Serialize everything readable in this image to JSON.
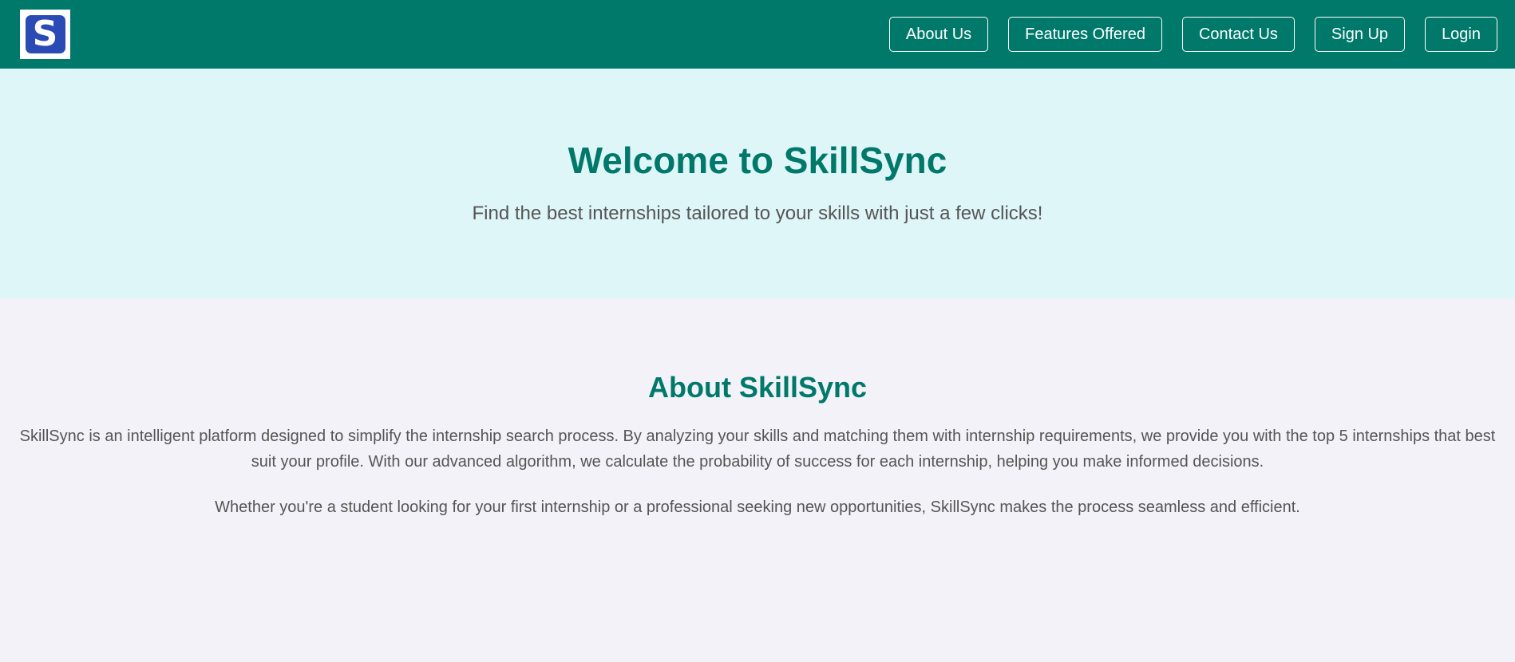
{
  "logo": {
    "letter": "S"
  },
  "nav": {
    "items": [
      {
        "label": "About Us"
      },
      {
        "label": "Features Offered"
      },
      {
        "label": "Contact Us"
      },
      {
        "label": "Sign Up"
      },
      {
        "label": "Login"
      }
    ]
  },
  "hero": {
    "title": "Welcome to SkillSync",
    "subtitle": "Find the best internships tailored to your skills with just a few clicks!"
  },
  "about": {
    "title": "About SkillSync",
    "paragraphs": [
      "SkillSync is an intelligent platform designed to simplify the internship search process. By analyzing your skills and matching them with internship requirements, we provide you with the top 5 internships that best suit your profile. With our advanced algorithm, we calculate the probability of success for each internship, helping you make informed decisions.",
      "Whether you're a student looking for your first internship or a professional seeking new opportunities, SkillSync makes the process seamless and efficient."
    ]
  },
  "colors": {
    "navbar": "#00796b",
    "accent": "#00796b",
    "hero_background": "#dff6f8",
    "page_background": "#f3f2f8",
    "logo_mark": "#2a4bb5"
  }
}
